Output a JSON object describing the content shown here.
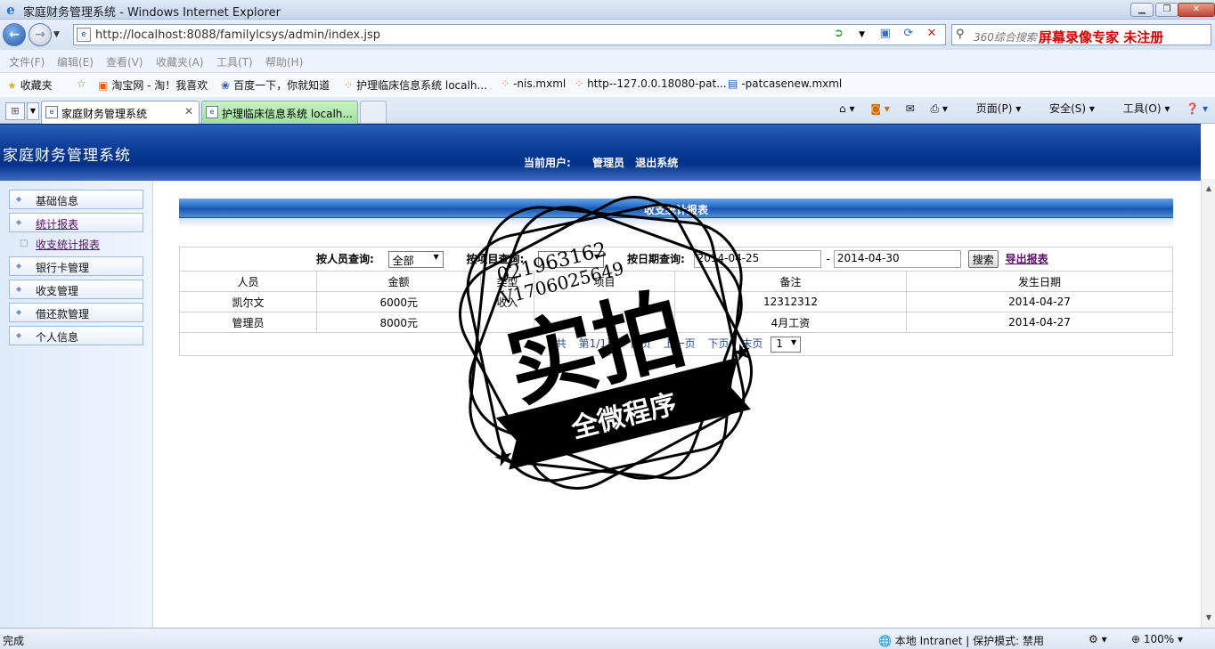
{
  "browser": {
    "window_title": "家庭财务管理系统 - Windows Internet Explorer",
    "url": "http://localhost:8088/familylcsys/admin/index.jsp",
    "search_placeholder": "360综合搜索",
    "search_promo": "屏幕录像专家  未注册",
    "menu": [
      "文件(F)",
      "编辑(E)",
      "查看(V)",
      "收藏夹(A)",
      "工具(T)",
      "帮助(H)"
    ],
    "favorites": [
      "收藏夹",
      "淘宝网 - 淘！我喜欢",
      "百度一下，你就知道",
      "护理临床信息系统 localh...",
      "-nis.mxml",
      "http--127.0.0.18080-pat...",
      "-patcasenew.mxml"
    ],
    "tabs": [
      {
        "label": "家庭财务管理系统",
        "active": true
      },
      {
        "label": "护理临床信息系统 localh...",
        "active": false
      }
    ],
    "command_bar": [
      "页面(P)",
      "安全(S)",
      "工具(O)"
    ],
    "status": {
      "left": "完成",
      "zone": "本地 Intranet | 保护模式: 禁用",
      "zoom": "100%"
    }
  },
  "app": {
    "title": "家庭财务管理系统",
    "current_user_label": "当前用户:",
    "current_user": "管理员",
    "logout": "退出系统"
  },
  "sidebar": {
    "items": [
      {
        "label": "基础信息"
      },
      {
        "label": "统计报表",
        "link": true
      },
      {
        "label": "收支统计报表",
        "sub": true
      },
      {
        "label": "银行卡管理"
      },
      {
        "label": "收支管理"
      },
      {
        "label": "借还款管理"
      },
      {
        "label": "个人信息"
      }
    ]
  },
  "report": {
    "title": "收支统计报表",
    "filters": {
      "person_label": "按人员查询:",
      "person_value": "全部",
      "item_label": "按项目查询:",
      "date_label": "按日期查询:",
      "date_from": "2014-04-25",
      "date_sep": "-",
      "date_to": "2014-04-30",
      "search_button": "搜索",
      "export_link": "导出报表"
    },
    "columns": [
      "人员",
      "金额",
      "类型",
      "项目",
      "备注",
      "发生日期"
    ],
    "rows": [
      [
        "凯尔文",
        "6000元",
        "收入",
        "",
        "12312312",
        "2014-04-27"
      ],
      [
        "管理员",
        "8000元",
        "",
        "",
        "4月工资",
        "2014-04-27"
      ]
    ],
    "pager": {
      "total_prefix": "共",
      "page_info": "第1/1页",
      "first": "首页",
      "prev": "上一页",
      "next": "下页",
      "last": "末页",
      "page_select": "1"
    }
  },
  "watermark": {
    "phone1": "021963162",
    "phone2": "V1706025649",
    "big": "实拍",
    "banner": "全微程序"
  },
  "colors": {
    "header_blue": "#03318a",
    "link_purple": "#5a0f6a",
    "promo_red": "#d40000"
  }
}
